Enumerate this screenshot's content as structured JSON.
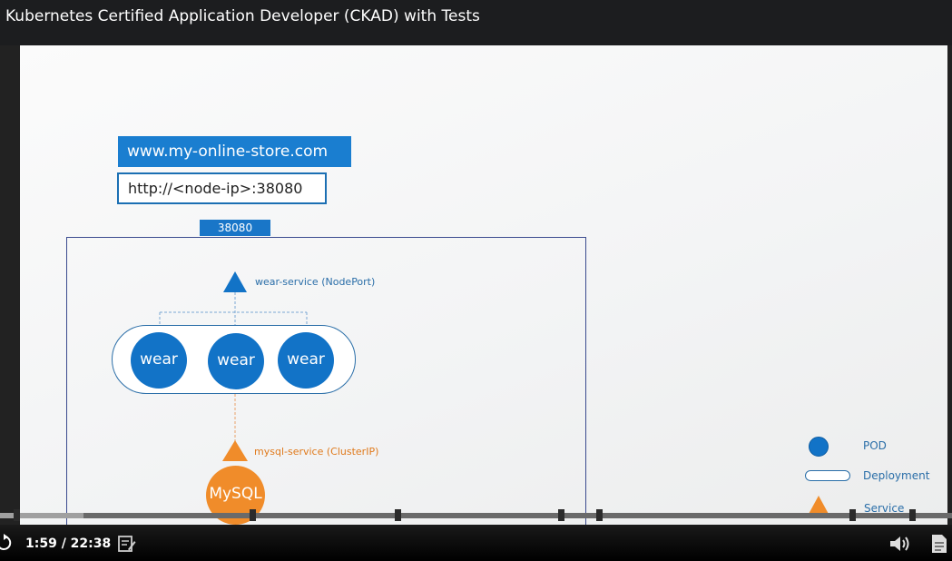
{
  "header": {
    "title": "Kubernetes Certified Application Developer (CKAD) with Tests"
  },
  "slide": {
    "url": "www.my-online-store.com",
    "node_url": "http://<node-ip>:38080",
    "node_port": "38080",
    "wear_service_label": "wear-service (NodePort)",
    "mysql_service_label": "mysql-service (ClusterIP)",
    "pods": [
      "wear",
      "wear",
      "wear"
    ],
    "mysql_pod": "MySQL",
    "legend": {
      "pod": "POD",
      "deployment": "Deployment",
      "service": "Service"
    },
    "colors": {
      "blue": "#1273c7",
      "orange": "#f08c2a"
    }
  },
  "player": {
    "time": "1:59 / 22:38",
    "progress_fraction": 0.088,
    "icons": [
      "replay-icon",
      "notes-icon",
      "volume-icon",
      "transcript-icon"
    ]
  }
}
